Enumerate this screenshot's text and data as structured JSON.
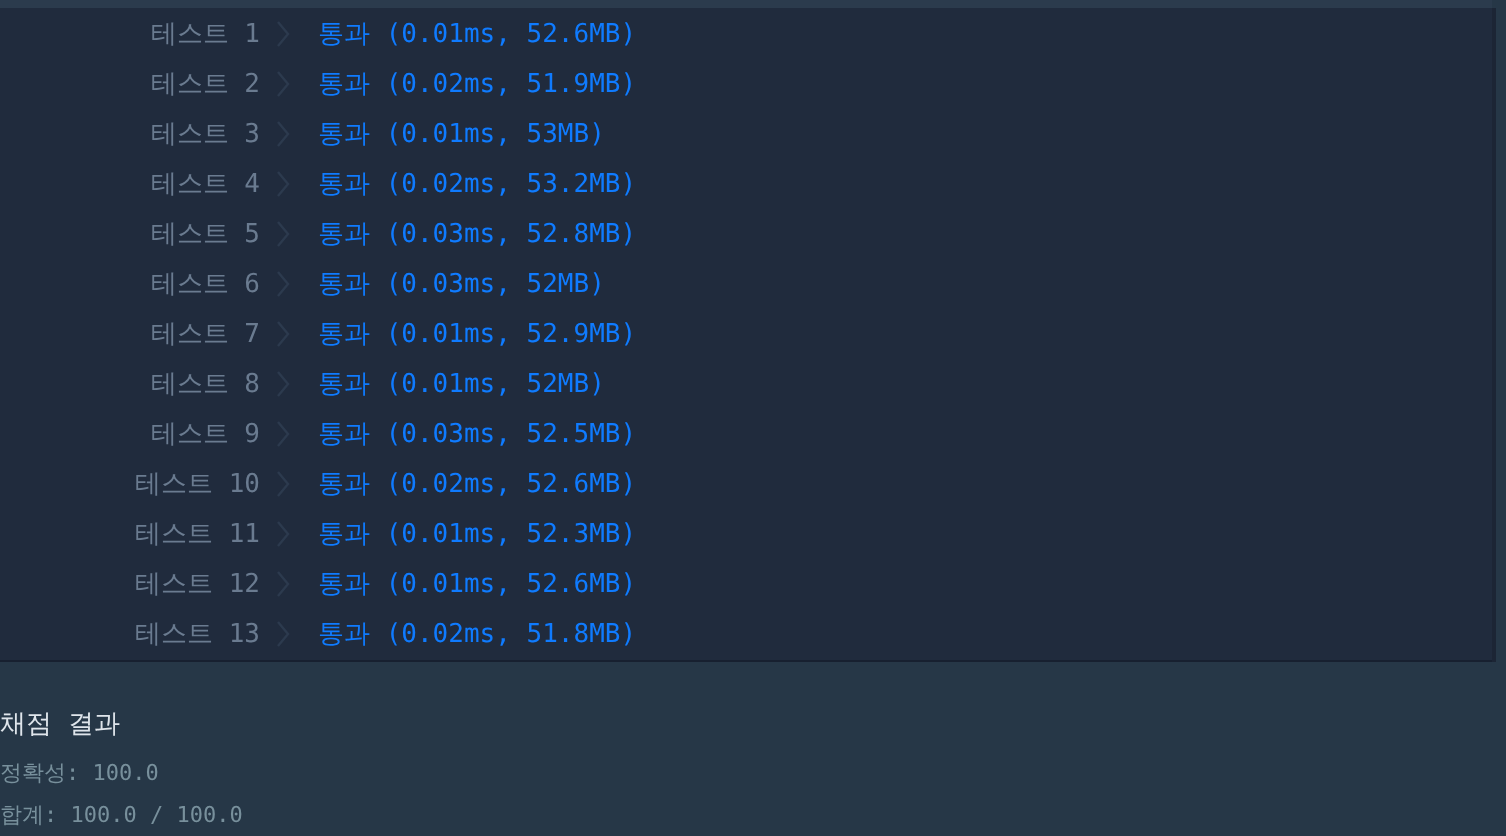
{
  "tests": [
    {
      "label": "테스트 1",
      "result": "통과 (0.01ms, 52.6MB)"
    },
    {
      "label": "테스트 2",
      "result": "통과 (0.02ms, 51.9MB)"
    },
    {
      "label": "테스트 3",
      "result": "통과 (0.01ms, 53MB)"
    },
    {
      "label": "테스트 4",
      "result": "통과 (0.02ms, 53.2MB)"
    },
    {
      "label": "테스트 5",
      "result": "통과 (0.03ms, 52.8MB)"
    },
    {
      "label": "테스트 6",
      "result": "통과 (0.03ms, 52MB)"
    },
    {
      "label": "테스트 7",
      "result": "통과 (0.01ms, 52.9MB)"
    },
    {
      "label": "테스트 8",
      "result": "통과 (0.01ms, 52MB)"
    },
    {
      "label": "테스트 9",
      "result": "통과 (0.03ms, 52.5MB)"
    },
    {
      "label": "테스트 10",
      "result": "통과 (0.02ms, 52.6MB)"
    },
    {
      "label": "테스트 11",
      "result": "통과 (0.01ms, 52.3MB)"
    },
    {
      "label": "테스트 12",
      "result": "통과 (0.01ms, 52.6MB)"
    },
    {
      "label": "테스트 13",
      "result": "통과 (0.02ms, 51.8MB)"
    }
  ],
  "summary": {
    "title": "채점 결과",
    "lines": [
      "정확성: 100.0",
      "합계: 100.0 / 100.0"
    ]
  }
}
